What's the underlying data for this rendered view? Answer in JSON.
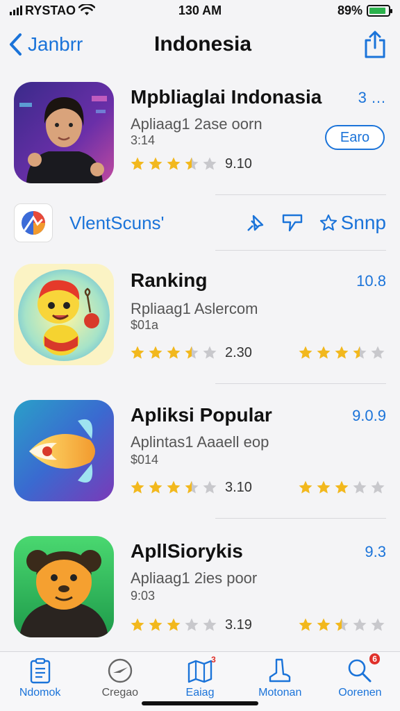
{
  "status": {
    "carrier": "RYSTAO",
    "time": "130 AM",
    "battery": "89%",
    "battery_level": 0.89
  },
  "nav": {
    "back_label": "Janbrr",
    "title": "Indonesia"
  },
  "featured": {
    "name": "Mpbliaglai Indonasia",
    "subtitle": "Apliaag1 2ase oorn",
    "price": "3:14",
    "rating": "9.10",
    "stars": 3.5,
    "right_num": "3 …",
    "button_label": "Earo"
  },
  "promo": {
    "label": "VlentScuns'",
    "action_label": "Snnp"
  },
  "apps": [
    {
      "name": "Ranking",
      "subtitle": "Rpliaag1 Aslercom",
      "price": "$01a",
      "rating": "2.30",
      "stars": 3.5,
      "right_num": "10.8",
      "right_stars": 3.5
    },
    {
      "name": "Apliksi Popular",
      "subtitle": "Aplintas1 Aaaell eop",
      "price": "$014",
      "rating": "3.10",
      "stars": 3.5,
      "right_num": "9.0.9",
      "right_stars": 3
    },
    {
      "name": "ApllSiorykis",
      "subtitle": "Apliaag1 2ies poor",
      "price": "9:03",
      "rating": "3.19",
      "stars": 3,
      "right_num": "9.3",
      "right_stars": 2.5
    }
  ],
  "tabs": [
    {
      "label": "Ndomok",
      "icon": "clipboard-icon",
      "badge": ""
    },
    {
      "label": "Cregao",
      "icon": "compass-icon",
      "badge": ""
    },
    {
      "label": "Eaiag",
      "icon": "map-icon",
      "badge": "3"
    },
    {
      "label": "Motonan",
      "icon": "boot-icon",
      "badge": ""
    },
    {
      "label": "Oorenen",
      "icon": "search-icon",
      "badge": "6"
    }
  ],
  "colors": {
    "accent": "#1a73d9",
    "star": "#f2b81d",
    "background": "#f4f4f6"
  }
}
